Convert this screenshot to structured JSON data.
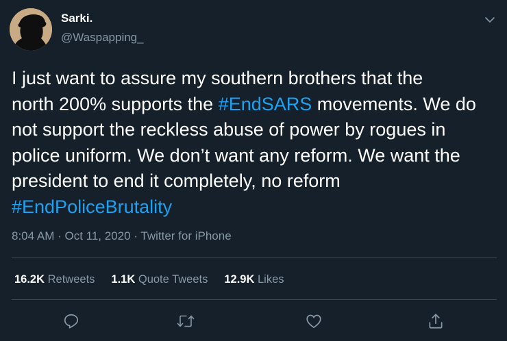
{
  "author": {
    "name": "Sarki.",
    "handle": "@Waspapping_"
  },
  "tweet": {
    "segments": [
      {
        "text": "I just want to assure my southern brothers that the\nnorth 200% supports the ",
        "hashtag": false
      },
      {
        "text": "#EndSARS",
        "hashtag": true
      },
      {
        "text": " movements. We do\nnot support the reckless abuse of power by rogues in\npolice uniform. We don’t want any reform. We want the\npresident to end it completely, no reform\n",
        "hashtag": false
      },
      {
        "text": "#EndPoliceBrutality",
        "hashtag": true
      }
    ]
  },
  "meta": {
    "time": "8:04 AM",
    "separator": " · ",
    "date": "Oct 11, 2020",
    "source": "Twitter for iPhone"
  },
  "stats": {
    "retweets": {
      "value": "16.2K",
      "label": "Retweets"
    },
    "quotes": {
      "value": "1.1K",
      "label": "Quote Tweets"
    },
    "likes": {
      "value": "12.9K",
      "label": "Likes"
    }
  },
  "icons": {
    "reply": "reply-icon",
    "retweet": "retweet-icon",
    "like": "like-icon",
    "share": "share-icon",
    "menu": "chevron-down-icon"
  },
  "colors": {
    "background": "#15202b",
    "text": "#ffffff",
    "secondary": "#8899a6",
    "accent": "#1da1f2",
    "divider": "#38444d"
  }
}
